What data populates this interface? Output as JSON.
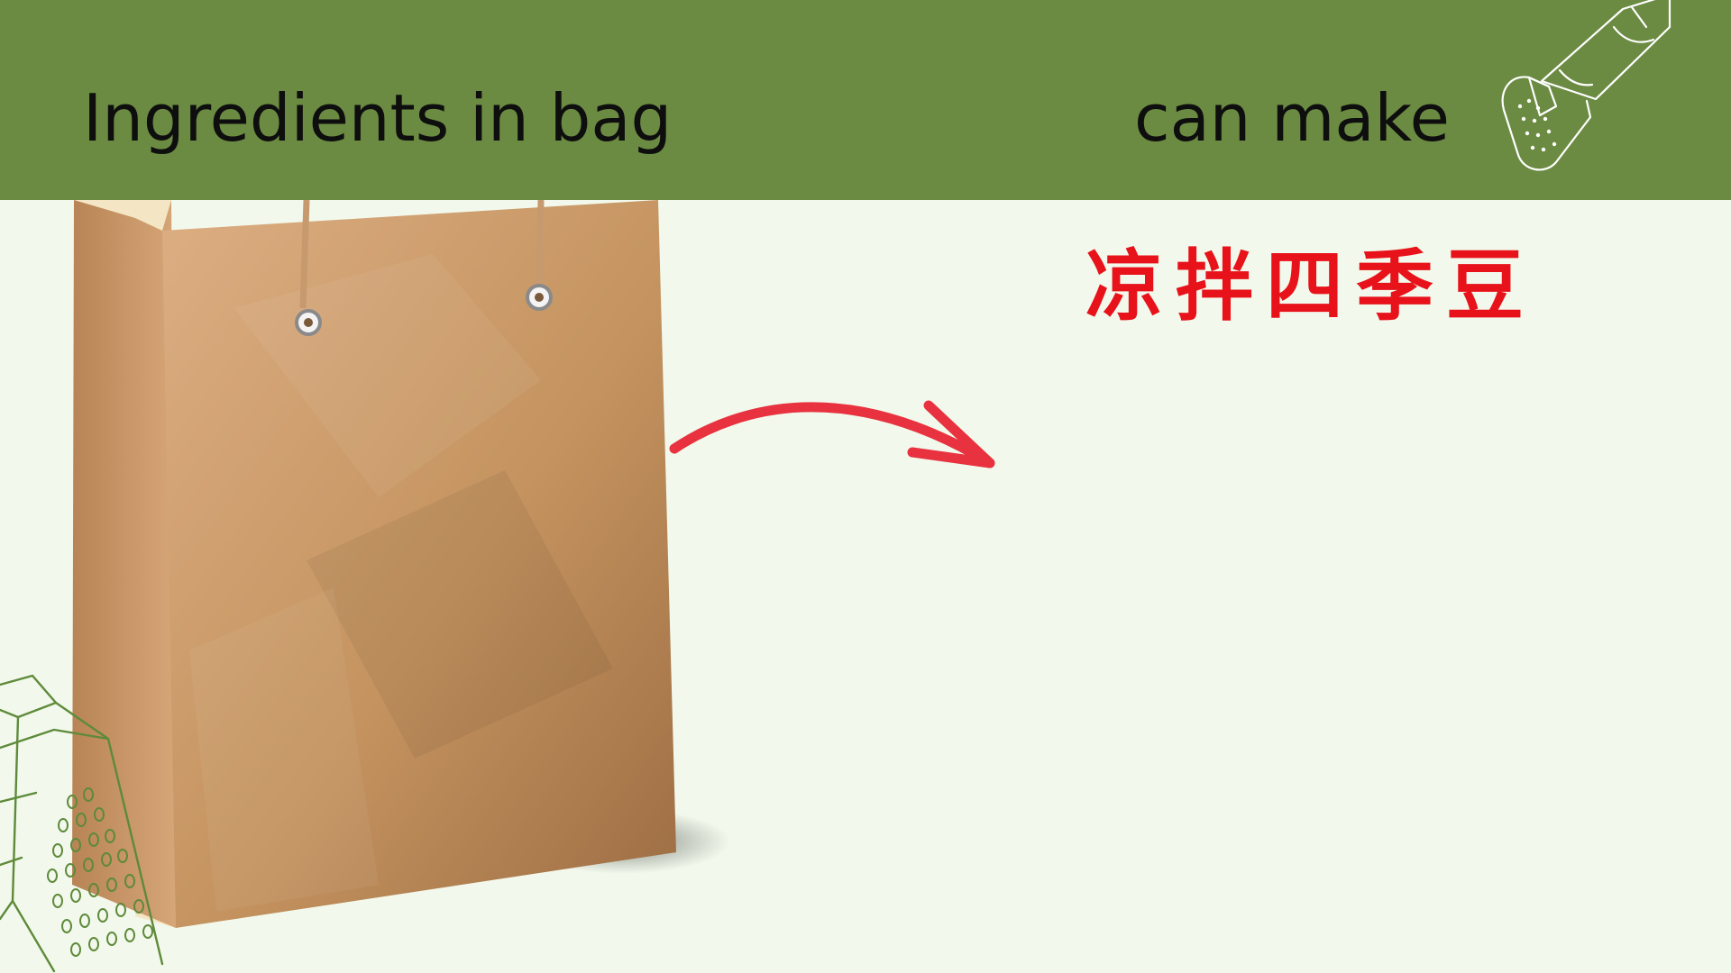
{
  "header": {
    "left_title": "Ingredients in bag",
    "right_title": "can make"
  },
  "result": {
    "dish_name": "凉拌四季豆"
  },
  "illustrations": {
    "bag": "paper-shopping-bag-icon",
    "arrow": "curved-arrow-icon",
    "shaker": "salt-shaker-icon",
    "grater": "cheese-grater-icon"
  },
  "colors": {
    "header_band": "#6b8b42",
    "background": "#f2f9ec",
    "dish_text": "#e8121a",
    "arrow": "#e8323f",
    "bag": "#c99664",
    "sketch_lines": "#ffffff",
    "grater_lines": "#5e8a3a"
  }
}
